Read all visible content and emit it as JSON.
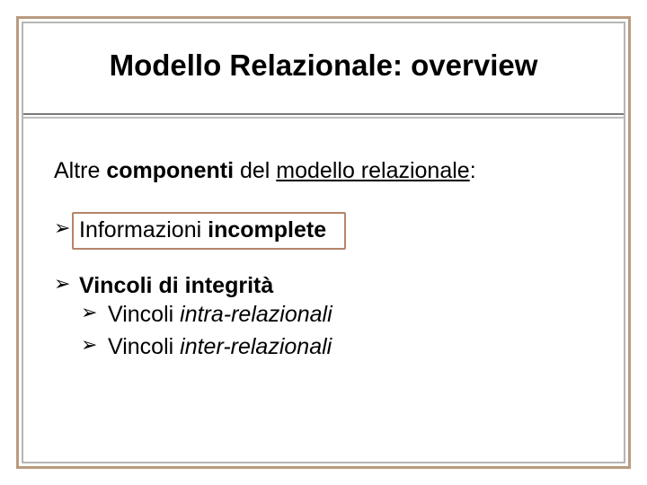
{
  "title": "Modello Relazionale: overview",
  "intro": {
    "prefix": "Altre ",
    "bold": "componenti",
    "mid": " del ",
    "underlined": "modello relazionale",
    "suffix": ":"
  },
  "item1": {
    "pre": "Informazioni ",
    "bold": "incomplete"
  },
  "item2": {
    "pre": "Vincoli di ",
    "bold": "integrità",
    "sub1": {
      "pre": "Vincoli ",
      "italic": "intra-relazionali"
    },
    "sub2": {
      "pre": "Vincoli ",
      "italic": "inter-relazionali"
    }
  },
  "bullet": "➢"
}
